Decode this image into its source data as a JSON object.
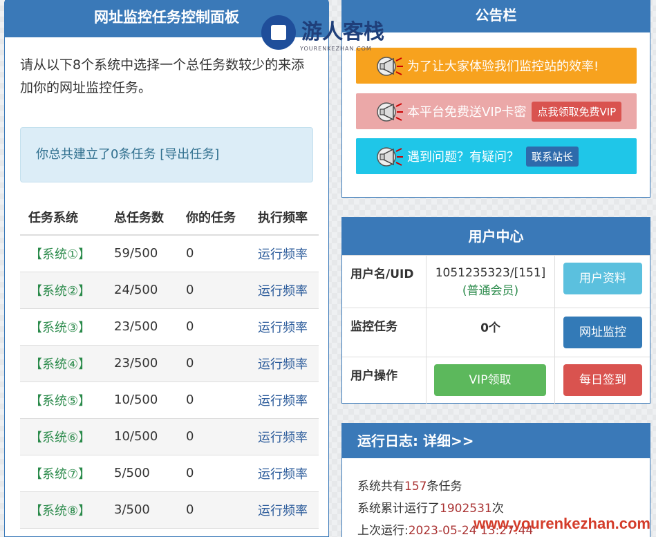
{
  "left_panel": {
    "title": "网址监控任务控制面板",
    "intro": "请从以下8个系统中选择一个总任务数较少的来添加你的网址监控任务。",
    "info_prefix": "你总共建立了0条任务 ",
    "info_link": "[导出任务]",
    "table": {
      "headers": [
        "任务系统",
        "总任务数",
        "你的任务",
        "执行频率"
      ],
      "rows": [
        {
          "system": "【系统①】",
          "total": "59/500",
          "mine": "0",
          "freq": "运行频率"
        },
        {
          "system": "【系统②】",
          "total": "24/500",
          "mine": "0",
          "freq": "运行频率"
        },
        {
          "system": "【系统③】",
          "total": "23/500",
          "mine": "0",
          "freq": "运行频率"
        },
        {
          "system": "【系统④】",
          "total": "23/500",
          "mine": "0",
          "freq": "运行频率"
        },
        {
          "system": "【系统⑤】",
          "total": "10/500",
          "mine": "0",
          "freq": "运行频率"
        },
        {
          "system": "【系统⑥】",
          "total": "10/500",
          "mine": "0",
          "freq": "运行频率"
        },
        {
          "system": "【系统⑦】",
          "total": "5/500",
          "mine": "0",
          "freq": "运行频率"
        },
        {
          "system": "【系统⑧】",
          "total": "3/500",
          "mine": "0",
          "freq": "运行频率"
        }
      ]
    }
  },
  "notice": {
    "title": "公告栏",
    "banner1": "为了让大家体验我们监控站的效率!",
    "banner2": "本平台免费送VIP卡密",
    "banner2_btn": "点我领取免费VIP",
    "banner3": "遇到问题？有疑问？",
    "banner3_btn": "联系站长",
    "icon": "megaphone-icon"
  },
  "user": {
    "title": "用户中心",
    "uid_label": "用户名/UID",
    "uid_value": "1051235323/[151]",
    "member": "(普通会员)",
    "profile_btn": "用户资料",
    "task_label": "监控任务",
    "task_value": "0个",
    "monitor_btn": "网址监控",
    "op_label": "用户操作",
    "vip_btn": "VIP领取",
    "sign_btn": "每日签到"
  },
  "log": {
    "title": "运行日志: 详细>>",
    "l1_a": "系统共有",
    "l1_num": "157",
    "l1_b": "条任务",
    "l2_a": "系统累计运行了",
    "l2_num": "1902531",
    "l2_b": "次",
    "l3_a": "上次运行:",
    "l3_num": "2023-05-24 13:27:44"
  },
  "watermark": {
    "logo_text": "游人客栈",
    "logo_sub": "YOURENKEZHAN.COM",
    "url": "www.yourenkezhan.com"
  },
  "colors": {
    "primary": "#3a79b8",
    "orange": "#f7a21e",
    "pink": "#eba8a8",
    "cyan": "#1fc6e8",
    "btn_info": "#5bc0de",
    "btn_primary": "#337ab7",
    "btn_success": "#5cb85c",
    "btn_danger": "#d9534f"
  }
}
